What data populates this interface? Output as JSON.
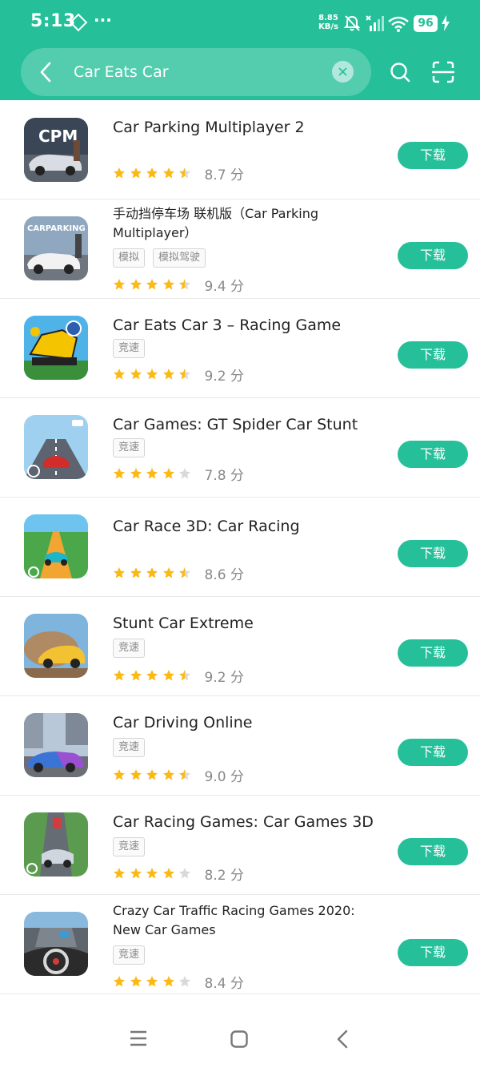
{
  "status_bar": {
    "time": "5:13",
    "more": "···",
    "net_speed_value": "8.85",
    "net_speed_unit": "KB/s",
    "battery": "96"
  },
  "search": {
    "query": "Car Eats Car",
    "placeholder": ""
  },
  "colors": {
    "accent": "#25bf99",
    "star": "#fbb914",
    "star_empty": "#d9d9d9"
  },
  "apps": [
    {
      "title": "Car Parking Multiplayer 2",
      "tags": [],
      "stars": 4.5,
      "score": "8.7 分",
      "button": "下载"
    },
    {
      "title": "手动挡停车场 联机版（Car Parking Multiplayer）",
      "tags": [
        "模拟",
        "模拟驾驶"
      ],
      "stars": 4.5,
      "score": "9.4 分",
      "button": "下载"
    },
    {
      "title": "Car Eats Car 3 – Racing Game",
      "tags": [
        "竞速"
      ],
      "stars": 4.5,
      "score": "9.2 分",
      "button": "下载"
    },
    {
      "title": "Car Games: GT Spider Car Stunt",
      "tags": [
        "竞速"
      ],
      "stars": 4,
      "score": "7.8 分",
      "button": "下载"
    },
    {
      "title": "Car Race 3D: Car Racing",
      "tags": [],
      "stars": 4.5,
      "score": "8.6 分",
      "button": "下载"
    },
    {
      "title": "Stunt Car Extreme",
      "tags": [
        "竞速"
      ],
      "stars": 4.5,
      "score": "9.2 分",
      "button": "下载"
    },
    {
      "title": "Car Driving Online",
      "tags": [
        "竞速"
      ],
      "stars": 4.5,
      "score": "9.0 分",
      "button": "下载"
    },
    {
      "title": "Car Racing Games: Car Games 3D",
      "tags": [
        "竞速"
      ],
      "stars": 4,
      "score": "8.2 分",
      "button": "下载"
    },
    {
      "title": "Crazy Car Traffic Racing Games 2020: New Car Games",
      "tags": [
        "竞速"
      ],
      "stars": 4,
      "score": "8.4 分",
      "button": "下载"
    }
  ],
  "icons": {
    "back": "back-arrow-icon",
    "clear": "clear-icon",
    "search": "search-icon",
    "scan": "scan-icon",
    "nav_menu": "menu-icon",
    "nav_home": "home-icon",
    "nav_back": "back-icon"
  }
}
